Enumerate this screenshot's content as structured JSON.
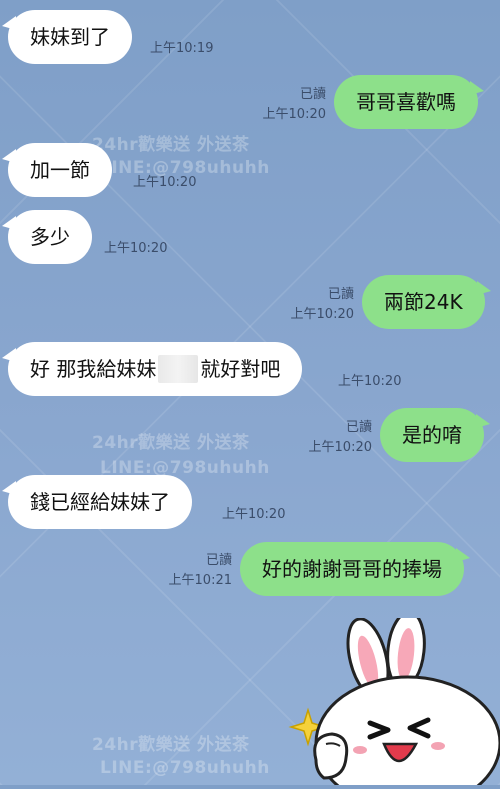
{
  "watermarks": [
    {
      "text": "24hr歡樂送 外送茶"
    },
    {
      "text": "LINE:@798uhuhh"
    }
  ],
  "messages": [
    {
      "side": "in",
      "text": "妹妹到了",
      "time": "上午10:19"
    },
    {
      "side": "out",
      "text": "哥哥喜歡嗎",
      "read": "已讀",
      "time": "上午10:20"
    },
    {
      "side": "in",
      "text": "加一節",
      "time": "上午10:20"
    },
    {
      "side": "in",
      "text": "多少",
      "time": "上午10:20"
    },
    {
      "side": "out",
      "text": "兩節24K",
      "read": "已讀",
      "time": "上午10:20"
    },
    {
      "side": "in",
      "text_before": "好 那我給妹妹",
      "text_after": "就好對吧",
      "time": "上午10:20"
    },
    {
      "side": "out",
      "text": "是的唷",
      "read": "已讀",
      "time": "上午10:20"
    },
    {
      "side": "in",
      "text": "錢已經給妹妹了",
      "time": "上午10:20"
    },
    {
      "side": "out",
      "text": "好的謝謝哥哥的捧場",
      "read": "已讀",
      "time": "上午10:21"
    }
  ],
  "sticker": {
    "icon": "rabbit-sticker-icon"
  },
  "colors": {
    "incoming": "#ffffff",
    "outgoing": "#8de08a",
    "background": "#8aa7cf"
  }
}
